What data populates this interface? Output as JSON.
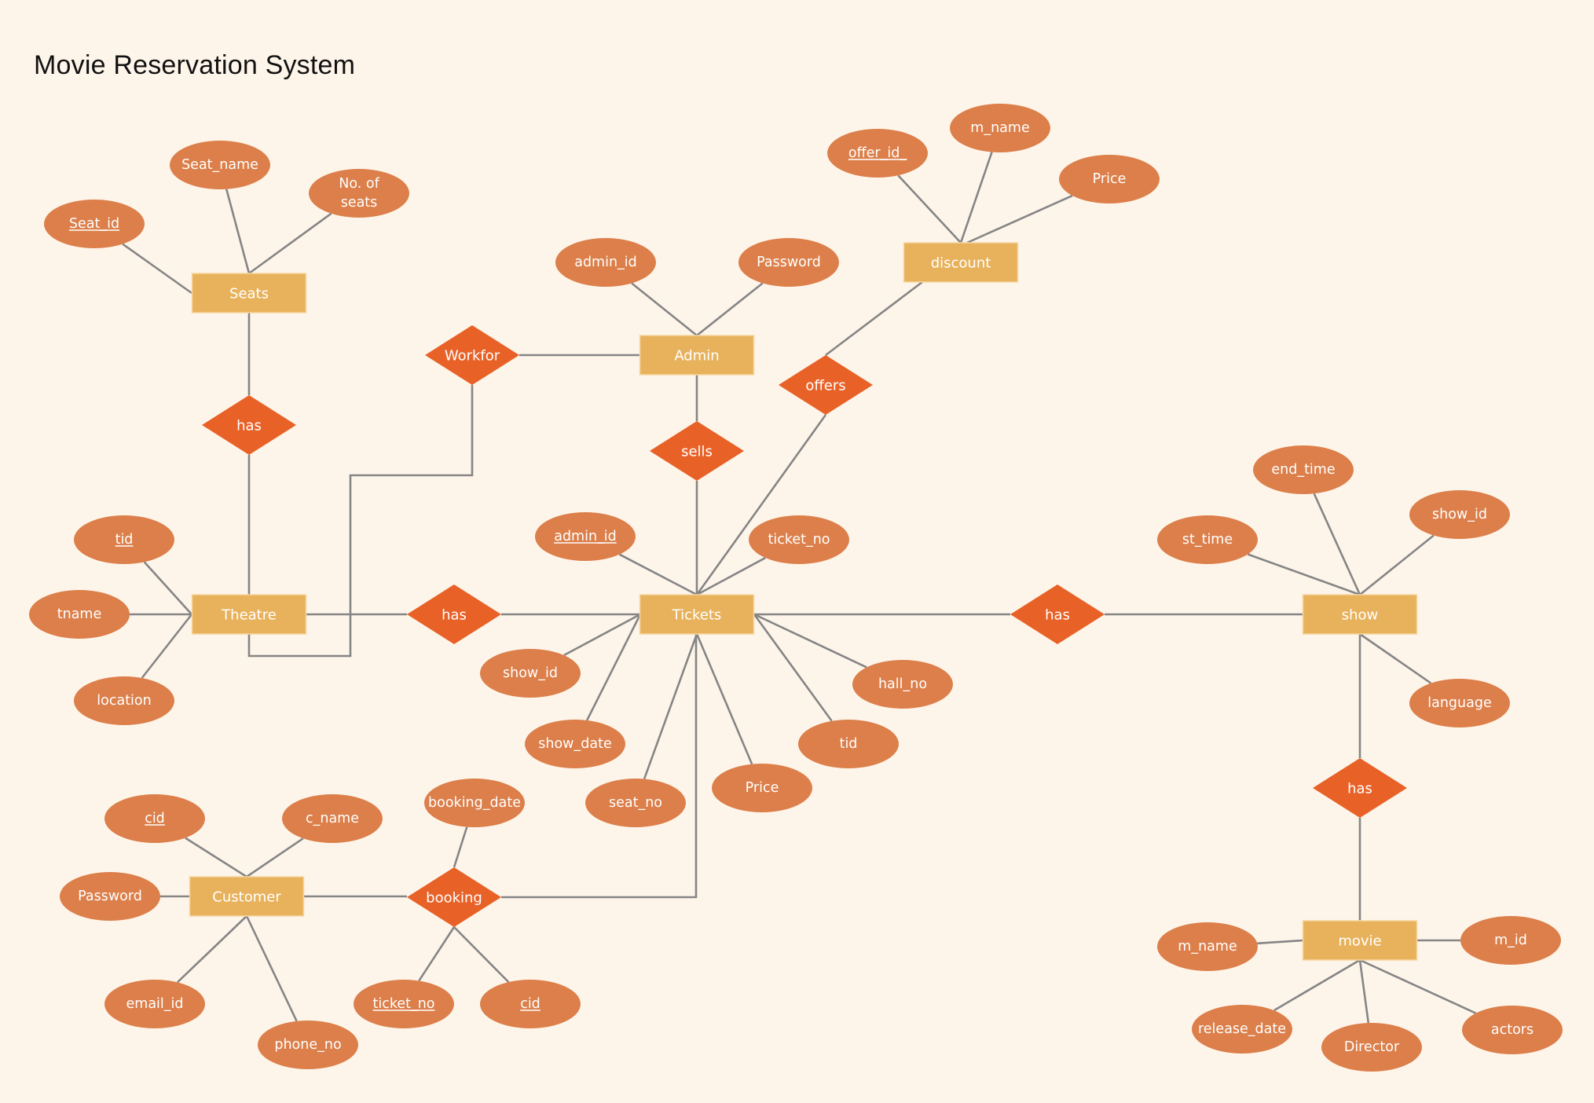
{
  "title": "Movie Reservation System",
  "colors": {
    "background": "#fef5ea",
    "entity": "#e8b25c",
    "relationship": "#e86228",
    "attribute": "#dc7f4a",
    "connector": "#858585",
    "label": "#ffffff"
  },
  "entities": [
    {
      "id": "seats",
      "label": "Seats"
    },
    {
      "id": "admin",
      "label": "Admin"
    },
    {
      "id": "discount",
      "label": "discount"
    },
    {
      "id": "theatre",
      "label": "Theatre"
    },
    {
      "id": "tickets",
      "label": "Tickets"
    },
    {
      "id": "show",
      "label": "show"
    },
    {
      "id": "customer",
      "label": "Customer"
    },
    {
      "id": "movie",
      "label": "movie"
    }
  ],
  "relationships": [
    {
      "id": "has_seats_theatre",
      "label": "has"
    },
    {
      "id": "workfor",
      "label": "Workfor"
    },
    {
      "id": "sells",
      "label": "sells"
    },
    {
      "id": "offers",
      "label": "offers"
    },
    {
      "id": "has_theatre_tickets",
      "label": "has"
    },
    {
      "id": "has_tickets_show",
      "label": "has"
    },
    {
      "id": "has_show_movie",
      "label": "has"
    },
    {
      "id": "booking",
      "label": "booking"
    }
  ],
  "attributes": [
    {
      "id": "seat_name",
      "label": "Seat_name",
      "key": false,
      "owner": "seats"
    },
    {
      "id": "seat_id",
      "label": "Seat_id",
      "key": true,
      "owner": "seats"
    },
    {
      "id": "no_of_seats",
      "label": "No. of seats",
      "lines": [
        "No. of",
        "seats"
      ],
      "key": false,
      "owner": "seats"
    },
    {
      "id": "admin_admin_id",
      "label": "admin_id",
      "key": false,
      "owner": "admin"
    },
    {
      "id": "admin_password",
      "label": "Password",
      "key": false,
      "owner": "admin"
    },
    {
      "id": "offer_id",
      "label": "offer_id_",
      "key": true,
      "owner": "discount"
    },
    {
      "id": "discount_m_name",
      "label": "m_name",
      "key": false,
      "owner": "discount"
    },
    {
      "id": "discount_price",
      "label": "Price",
      "key": false,
      "owner": "discount"
    },
    {
      "id": "theatre_tid",
      "label": "tid",
      "key": true,
      "owner": "theatre"
    },
    {
      "id": "tname",
      "label": "tname",
      "key": false,
      "owner": "theatre"
    },
    {
      "id": "location",
      "label": "location",
      "key": false,
      "owner": "theatre"
    },
    {
      "id": "tickets_admin_id",
      "label": "admin_id",
      "key": true,
      "owner": "tickets"
    },
    {
      "id": "tickets_ticket_no",
      "label": "ticket_no",
      "key": false,
      "owner": "tickets"
    },
    {
      "id": "tickets_show_id",
      "label": "show_id",
      "key": false,
      "owner": "tickets"
    },
    {
      "id": "show_date",
      "label": "show_date",
      "key": false,
      "owner": "tickets"
    },
    {
      "id": "seat_no",
      "label": "seat_no",
      "key": false,
      "owner": "tickets"
    },
    {
      "id": "tickets_price",
      "label": "Price",
      "key": false,
      "owner": "tickets"
    },
    {
      "id": "tickets_tid",
      "label": "tid",
      "key": false,
      "owner": "tickets"
    },
    {
      "id": "hall_no",
      "label": "hall_no",
      "key": false,
      "owner": "tickets"
    },
    {
      "id": "end_time",
      "label": "end_time",
      "key": false,
      "owner": "show"
    },
    {
      "id": "st_time",
      "label": "st_time",
      "key": false,
      "owner": "show"
    },
    {
      "id": "show_show_id",
      "label": "show_id",
      "key": false,
      "owner": "show"
    },
    {
      "id": "language",
      "label": "language",
      "key": false,
      "owner": "show"
    },
    {
      "id": "customer_cid",
      "label": "cid",
      "key": true,
      "owner": "customer"
    },
    {
      "id": "c_name",
      "label": "c_name",
      "key": false,
      "owner": "customer"
    },
    {
      "id": "customer_password",
      "label": "Password",
      "key": false,
      "owner": "customer"
    },
    {
      "id": "email_id",
      "label": "email_id",
      "key": false,
      "owner": "customer"
    },
    {
      "id": "phone_no",
      "label": "phone_no",
      "key": false,
      "owner": "customer"
    },
    {
      "id": "booking_date",
      "label": "booking_date",
      "key": false,
      "owner": "booking"
    },
    {
      "id": "booking_ticket_no",
      "label": "ticket_no",
      "key": true,
      "owner": "booking"
    },
    {
      "id": "booking_cid",
      "label": "cid",
      "key": true,
      "owner": "booking"
    },
    {
      "id": "movie_m_name",
      "label": "m_name",
      "key": false,
      "owner": "movie"
    },
    {
      "id": "m_id",
      "label": "m_id",
      "key": false,
      "owner": "movie"
    },
    {
      "id": "release_date",
      "label": "release_date",
      "key": false,
      "owner": "movie"
    },
    {
      "id": "director",
      "label": "Director",
      "key": false,
      "owner": "movie"
    },
    {
      "id": "actors",
      "label": "actors",
      "key": false,
      "owner": "movie"
    }
  ],
  "links": [
    [
      "seats",
      "has_seats_theatre"
    ],
    [
      "has_seats_theatre",
      "theatre"
    ],
    [
      "admin",
      "workfor"
    ],
    [
      "workfor",
      "theatre"
    ],
    [
      "admin",
      "sells"
    ],
    [
      "sells",
      "tickets"
    ],
    [
      "discount",
      "offers"
    ],
    [
      "offers",
      "tickets"
    ],
    [
      "theatre",
      "has_theatre_tickets"
    ],
    [
      "has_theatre_tickets",
      "tickets"
    ],
    [
      "tickets",
      "has_tickets_show"
    ],
    [
      "has_tickets_show",
      "show"
    ],
    [
      "show",
      "has_show_movie"
    ],
    [
      "has_show_movie",
      "movie"
    ],
    [
      "customer",
      "booking"
    ],
    [
      "booking",
      "tickets"
    ]
  ]
}
